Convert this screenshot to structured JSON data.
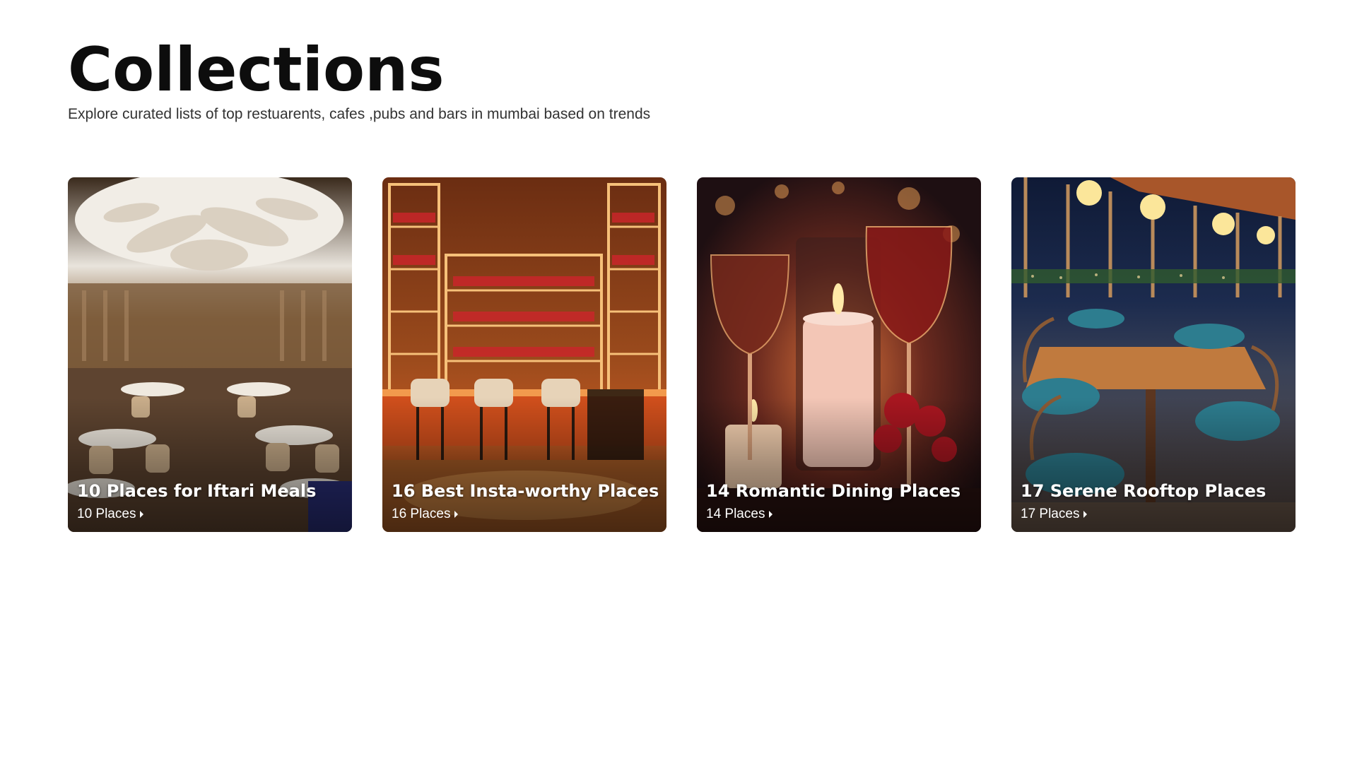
{
  "page": {
    "title": "Collections",
    "subtitle": "Explore curated lists of top restuarents, cafes ,pubs and bars in mumbai based on trends"
  },
  "collections": [
    {
      "title": "10 Places for Iftari Meals",
      "count": "10 Places",
      "image": "luxury-dining-hall-with-chandelier"
    },
    {
      "title": "16 Best Insta-worthy Places",
      "count": "16 Places",
      "image": "illuminated-bar-with-stools"
    },
    {
      "title": "14 Romantic Dining Places",
      "count": "14 Places",
      "image": "candles-and-wine-glasses"
    },
    {
      "title": "17 Serene Rooftop Places",
      "count": "17 Places",
      "image": "rooftop-terrace-dining-at-night"
    }
  ]
}
